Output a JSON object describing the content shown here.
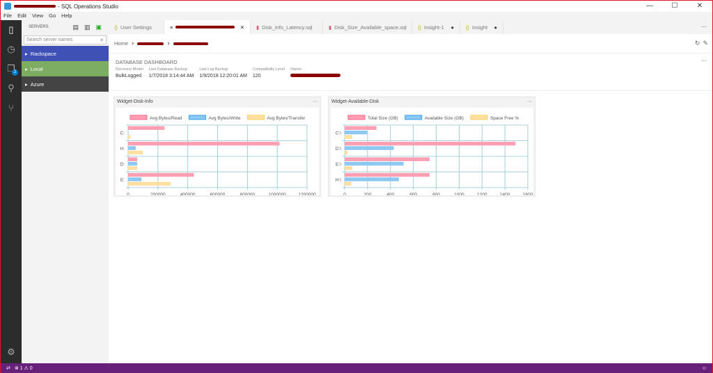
{
  "window": {
    "title": "- SQL Operations Studio",
    "controls": [
      "—",
      "☐",
      "✕"
    ]
  },
  "menu": [
    "File",
    "Edit",
    "View",
    "Go",
    "Help"
  ],
  "activity": {
    "badge": "2"
  },
  "sidebar": {
    "header": "SERVERS",
    "search_placeholder": "Search server names",
    "groups": [
      {
        "label": "Rackspace",
        "color": "#3f51b5"
      },
      {
        "label": "Local",
        "color": "#7cad62"
      },
      {
        "label": "Azure",
        "color": "#444444"
      }
    ]
  },
  "tabs": [
    {
      "label": "User Settings",
      "icon": "{}"
    },
    {
      "label": "",
      "icon": "≡",
      "active": true
    },
    {
      "label": "Disk_info_Latency.sql",
      "icon": "db"
    },
    {
      "label": "Disk_Size_Available_space.sql",
      "icon": "db"
    },
    {
      "label": "Insight-1",
      "icon": "{}",
      "dirty": true
    },
    {
      "label": "Insight",
      "icon": "{}",
      "dirty": true
    }
  ],
  "breadcrumb": {
    "home": "Home"
  },
  "dashboard": {
    "title": "DATABASE DASHBOARD",
    "props": [
      {
        "label": "Recovery Model",
        "value": "BulkLogged"
      },
      {
        "label": "Last Database Backup",
        "value": "1/7/2018 3:14:44 AM"
      },
      {
        "label": "Last Log Backup",
        "value": "1/9/2018 12:20:01 AM"
      },
      {
        "label": "Compatibility Level",
        "value": "120"
      },
      {
        "label": "Owner",
        "value": ""
      }
    ]
  },
  "status": {
    "errors": "1",
    "warnings": "0"
  },
  "chart_data": [
    {
      "type": "bar",
      "orientation": "horizontal",
      "title": "Widget-Disk-Info",
      "categories": [
        "C:",
        "H:",
        "D:",
        "E:"
      ],
      "xlim": [
        0,
        1200000
      ],
      "xticks": [
        0,
        200000,
        400000,
        600000,
        800000,
        1000000,
        1200000
      ],
      "grid": true,
      "legend": "top",
      "series": [
        {
          "name": "Avg Bytes/Read",
          "color": "#ff9fb3",
          "values": [
            244000,
            1015000,
            61000,
            441000
          ]
        },
        {
          "name": "Avg Bytes/Write",
          "color": "#8cc8f2",
          "values": [
            2000,
            51000,
            61000,
            90000
          ]
        },
        {
          "name": "Avg Bytes/Transfer",
          "color": "#ffe0a0",
          "values": [
            15000,
            99000,
            61000,
            286000
          ]
        }
      ]
    },
    {
      "type": "bar",
      "orientation": "horizontal",
      "title": "Widget-Available-Disk",
      "categories": [
        "C:\\",
        "D:\\",
        "E:\\",
        "H:\\"
      ],
      "xlim": [
        0,
        1600
      ],
      "xticks": [
        0,
        200,
        400,
        600,
        800,
        1000,
        1200,
        1400,
        1600
      ],
      "grid": true,
      "legend": "top",
      "series": [
        {
          "name": "Total Size (GB)",
          "color": "#ff9fb3",
          "values": [
            278,
            1492,
            742,
            742
          ]
        },
        {
          "name": "Available Size (GB)",
          "color": "#8cc8f2",
          "values": [
            196,
            429,
            515,
            474
          ]
        },
        {
          "name": "Space Free %",
          "color": "#ffe0a0",
          "values": [
            67,
            25,
            67,
            59
          ]
        }
      ]
    }
  ]
}
